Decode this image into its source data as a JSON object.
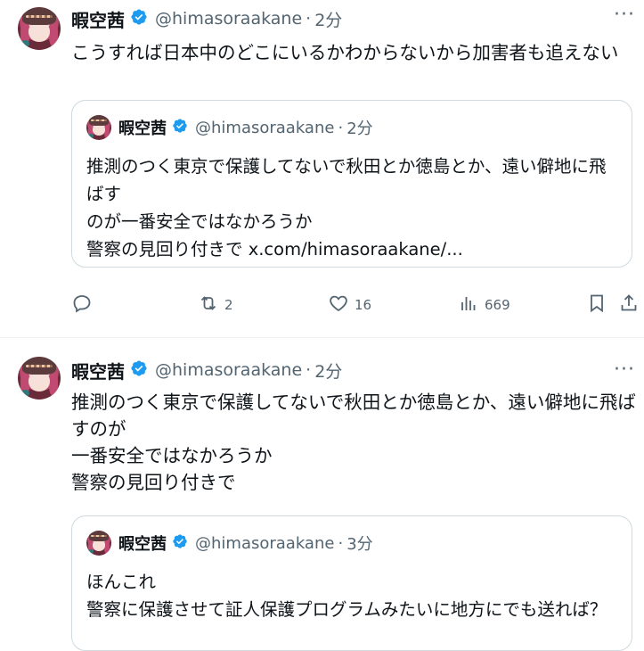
{
  "tweets": [
    {
      "author": {
        "name": "暇空茜",
        "handle": "@himasoraakane",
        "time": "2分"
      },
      "text": "こうすれば日本中のどこにいるかわからないから加害者も追えない",
      "quote": {
        "author": {
          "name": "暇空茜",
          "handle": "@himasoraakane",
          "time": "2分"
        },
        "text": "推測のつく東京で保護してないで秋田とか徳島とか、遠い僻地に飛ばす\nのが一番安全ではなかろうか\n警察の見回り付きで x.com/himasoraakane/..."
      },
      "actions": {
        "replies": "",
        "reposts": "2",
        "likes": "16",
        "views": "669"
      },
      "more_label": "···"
    },
    {
      "author": {
        "name": "暇空茜",
        "handle": "@himasoraakane",
        "time": "2分"
      },
      "text": "推測のつく東京で保護してないで秋田とか徳島とか、遠い僻地に飛ばすのが\n一番安全ではなかろうか\n警察の見回り付きで",
      "quote": {
        "author": {
          "name": "暇空茜",
          "handle": "@himasoraakane",
          "time": "3分"
        },
        "text": "ほんこれ\n警察に保護させて証人保護プログラムみたいに地方にでも送れば？"
      },
      "more_label": "···"
    }
  ],
  "separator": "·",
  "colors": {
    "accent": "#1d9bf0",
    "text": "#0f1419",
    "secondary": "#536471",
    "border": "#cfd9de"
  },
  "icons": [
    "verified-badge-icon",
    "reply-icon",
    "repost-icon",
    "like-icon",
    "views-icon",
    "bookmark-icon",
    "share-icon",
    "more-icon"
  ]
}
